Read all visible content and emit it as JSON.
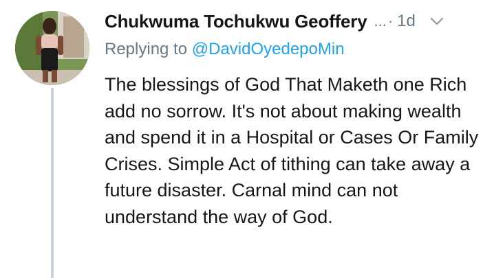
{
  "tweet": {
    "author_name": "Chukwuma Tochukwu Geoffery",
    "truncation": "...",
    "separator": "·",
    "timestamp": "1d",
    "reply_prefix": "Replying to",
    "reply_handle": "@DavidOyedepoMin",
    "text": "The blessings of God That Maketh one Rich add no sorrow. It's not about making wealth and spend it in a Hospital or Cases Or Family Crises. Simple Act of tithing can take away a future disaster. Carnal mind can not understand the way of God.",
    "icons": {
      "avatar": "profile-photo",
      "menu": "chevron-down-icon"
    },
    "colors": {
      "name": "#14171a",
      "muted": "#657786",
      "link": "#1da1f2",
      "thread_line": "#c6d0d7"
    }
  }
}
